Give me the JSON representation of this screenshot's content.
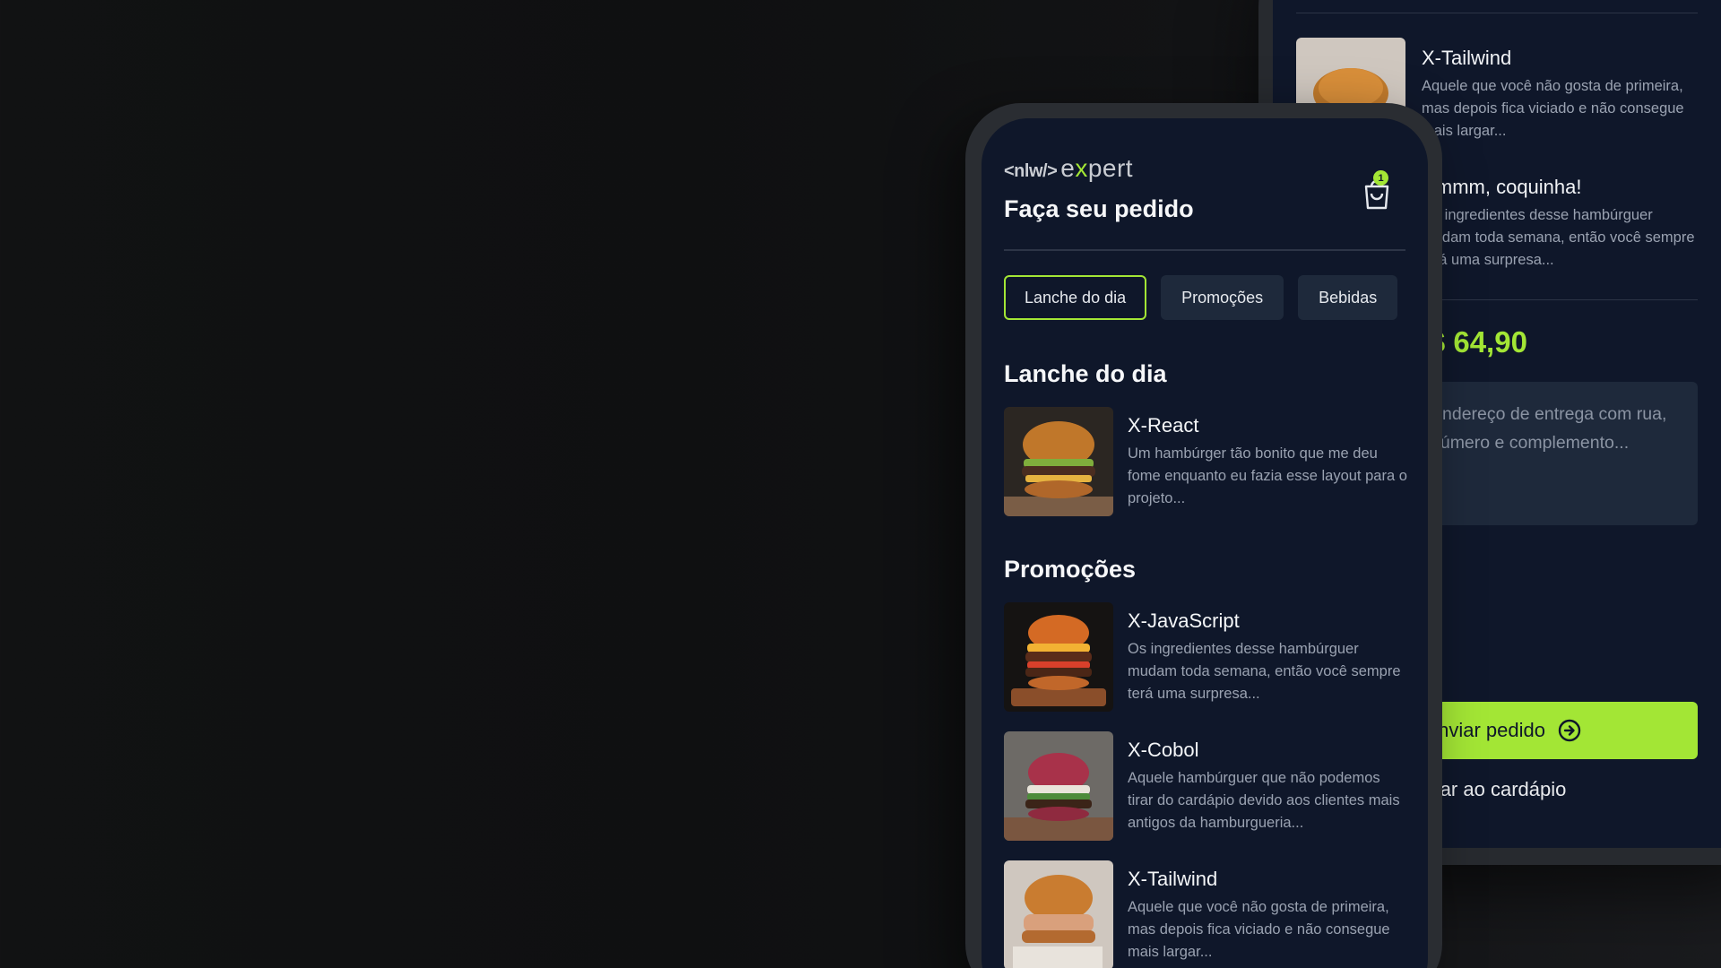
{
  "back_screen": {
    "items": [
      {
        "name": "X-Tailwind",
        "description": "Aquele que você não gosta de primeira, mas depois fica viciado e não consegue mais largar..."
      },
      {
        "name": "Hmmm, coquinha!",
        "description": "Os ingredientes desse hambúrguer mudam toda semana, então você sempre terá uma surpresa..."
      }
    ],
    "total": "R$ 64,90",
    "address_placeholder": "Endereço de entrega com rua, número e complemento...",
    "send_button": "Enviar pedido",
    "back_link": "Voltar ao cardápio"
  },
  "front_screen": {
    "logo": {
      "prefix": "<nlw/>",
      "word_start": "e",
      "word_x": "x",
      "word_end": "pert"
    },
    "title": "Faça seu pedido",
    "cart_count": "1",
    "tabs": [
      {
        "label": "Lanche do dia",
        "active": true
      },
      {
        "label": "Promoções",
        "active": false
      },
      {
        "label": "Bebidas",
        "active": false
      }
    ],
    "sections": [
      {
        "title": "Lanche do dia",
        "items": [
          {
            "name": "X-React",
            "description": "Um hambúrger tão bonito que me deu fome enquanto eu fazia esse layout para o projeto..."
          }
        ]
      },
      {
        "title": "Promoções",
        "items": [
          {
            "name": "X-JavaScript",
            "description": "Os ingredientes desse hambúrguer mudam toda semana, então você sempre terá uma surpresa..."
          },
          {
            "name": "X-Cobol",
            "description": "Aquele hambúrguer que não podemos tirar do cardápio devido aos clientes mais antigos da hamburgueria..."
          },
          {
            "name": "X-Tailwind",
            "description": "Aquele que você não gosta de primeira, mas depois fica viciado e não consegue mais largar..."
          }
        ]
      }
    ]
  },
  "colors": {
    "accent": "#a3e635",
    "surface": "#0f172a",
    "card": "#1e293b",
    "frame": "#2a2d32"
  }
}
